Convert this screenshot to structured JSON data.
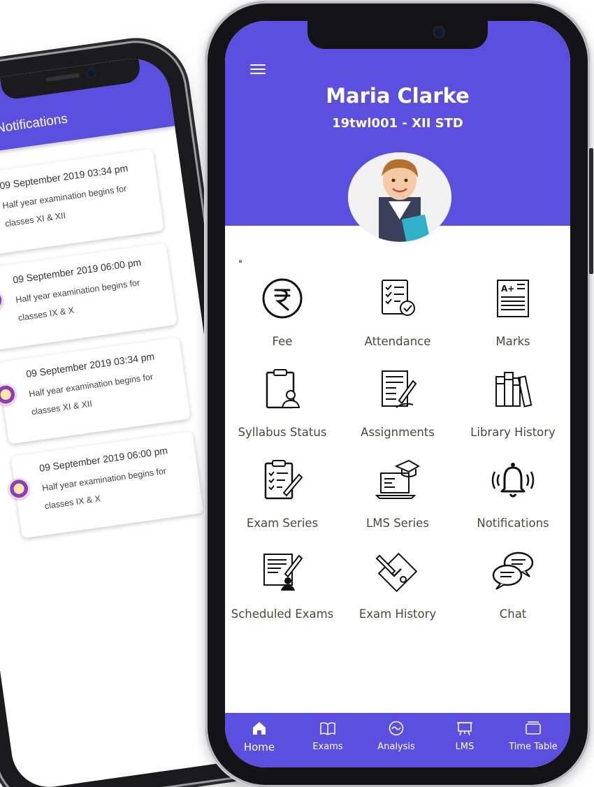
{
  "notifications_screen": {
    "title": "Notifications",
    "items": [
      {
        "date": "09 September 2019 03:34 pm",
        "message": "Half year examination begins for classes XI & XII"
      },
      {
        "date": "09 September 2019 06:00 pm",
        "message": "Half year examination begins for classes IX & X"
      },
      {
        "date": "09 September 2019 03:34 pm",
        "message": "Half year examination begins for classes XI & XII"
      },
      {
        "date": "09 September 2019 06:00 pm",
        "message": "Half year examination begins for classes IX & X"
      }
    ]
  },
  "profile": {
    "name": "Maria Clarke",
    "id_class": "19twl001 - XII STD"
  },
  "menu": [
    {
      "label": "Fee",
      "icon": "rupee-icon"
    },
    {
      "label": "Attendance",
      "icon": "attendance-checklist-icon"
    },
    {
      "label": "Marks",
      "icon": "marks-sheet-icon"
    },
    {
      "label": "Syllabus Status",
      "icon": "clipboard-person-icon"
    },
    {
      "label": "Assignments",
      "icon": "assignment-icon"
    },
    {
      "label": "Library History",
      "icon": "books-icon"
    },
    {
      "label": "Exam Series",
      "icon": "exam-clipboard-icon"
    },
    {
      "label": "LMS Series",
      "icon": "laptop-graduation-icon"
    },
    {
      "label": "Notifications",
      "icon": "bell-icon"
    },
    {
      "label": "Scheduled Exams",
      "icon": "scheduled-exam-icon"
    },
    {
      "label": "Exam History",
      "icon": "exam-history-icon"
    },
    {
      "label": "Chat",
      "icon": "chat-bubbles-icon"
    }
  ],
  "bottom_nav": [
    {
      "label": "Home",
      "icon": "home-icon",
      "active": true
    },
    {
      "label": "Exams",
      "icon": "book-icon",
      "active": false
    },
    {
      "label": "Analysis",
      "icon": "analysis-icon",
      "active": false
    },
    {
      "label": "LMS",
      "icon": "board-icon",
      "active": false
    },
    {
      "label": "Time Table",
      "icon": "timetable-icon",
      "active": false
    }
  ],
  "colors": {
    "primary": "#5b4fe0",
    "label_text": "#4a4a3a",
    "background": "#ffffff"
  }
}
